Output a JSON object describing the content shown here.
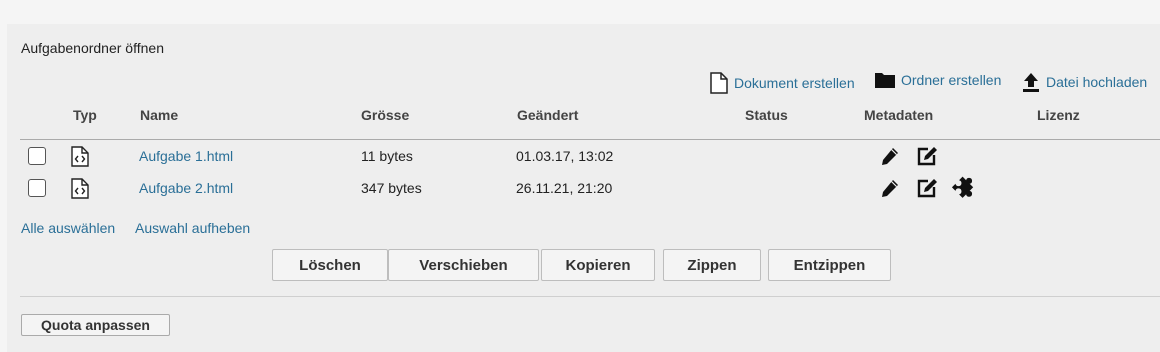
{
  "folder": {
    "title": "Aufgabenordner öffnen"
  },
  "toolbar": {
    "create_document": "Dokument erstellen",
    "create_folder": "Ordner erstellen",
    "upload_file": "Datei hochladen"
  },
  "table": {
    "headers": {
      "type": "Typ",
      "name": "Name",
      "size": "Grösse",
      "modified": "Geändert",
      "status": "Status",
      "metadata": "Metadaten",
      "license": "Lizenz"
    },
    "rows": [
      {
        "name": "Aufgabe 1.html",
        "size": "11 bytes",
        "modified": "01.03.17, 13:02",
        "status": "",
        "license": "",
        "icons": [
          "pencil-icon",
          "edit-metadata-icon"
        ]
      },
      {
        "name": "Aufgabe 2.html",
        "size": "347 bytes",
        "modified": "26.11.21, 21:20",
        "status": "",
        "license": "",
        "icons": [
          "pencil-icon",
          "edit-metadata-icon",
          "puzzle-icon"
        ]
      }
    ]
  },
  "selection": {
    "select_all": "Alle auswählen",
    "deselect": "Auswahl aufheben"
  },
  "buttons": {
    "delete": "Löschen",
    "move": "Verschieben",
    "copy": "Kopieren",
    "zip": "Zippen",
    "unzip": "Entzippen"
  },
  "quota": {
    "label": "Quota anpassen"
  },
  "colors": {
    "link": "#2a6f97",
    "panel": "#eeeeee",
    "page": "#f5f5f5"
  }
}
